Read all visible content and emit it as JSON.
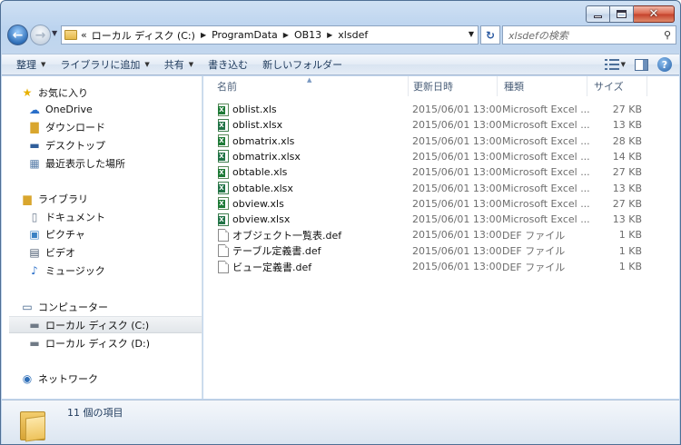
{
  "window": {
    "caption_buttons": {
      "close_symbol": "✕"
    }
  },
  "navbar": {
    "breadcrumb_overflow": "«",
    "breadcrumbs": [
      "ローカル ディスク (C:)",
      "ProgramData",
      "OB13",
      "xlsdef"
    ],
    "search_placeholder": "xlsdefの検索",
    "refresh_symbol": "↻",
    "back_symbol": "←",
    "forward_symbol": "→"
  },
  "toolbar": {
    "organize": "整理",
    "add_to_library": "ライブラリに追加",
    "share": "共有",
    "burn": "書き込む",
    "new_folder": "新しいフォルダー"
  },
  "navpane": {
    "favorites": "お気に入り",
    "onedrive": "OneDrive",
    "downloads": "ダウンロード",
    "desktop": "デスクトップ",
    "recent": "最近表示した場所",
    "libraries": "ライブラリ",
    "documents": "ドキュメント",
    "pictures": "ピクチャ",
    "videos": "ビデオ",
    "music": "ミュージック",
    "computer": "コンピューター",
    "local_c": "ローカル ディスク (C:)",
    "local_d": "ローカル ディスク (D:)",
    "network": "ネットワーク"
  },
  "columns": {
    "name": "名前",
    "date": "更新日時",
    "type": "種類",
    "size": "サイズ"
  },
  "files": [
    {
      "name": "oblist.xls",
      "date": "2015/06/01 13:00",
      "type": "Microsoft Excel ...",
      "size": "27 KB",
      "icon": "xls-icon"
    },
    {
      "name": "oblist.xlsx",
      "date": "2015/06/01 13:00",
      "type": "Microsoft Excel ...",
      "size": "13 KB",
      "icon": "xlsx-icon"
    },
    {
      "name": "obmatrix.xls",
      "date": "2015/06/01 13:00",
      "type": "Microsoft Excel ...",
      "size": "28 KB",
      "icon": "xls-icon"
    },
    {
      "name": "obmatrix.xlsx",
      "date": "2015/06/01 13:00",
      "type": "Microsoft Excel ...",
      "size": "14 KB",
      "icon": "xlsx-icon"
    },
    {
      "name": "obtable.xls",
      "date": "2015/06/01 13:00",
      "type": "Microsoft Excel ...",
      "size": "27 KB",
      "icon": "xls-icon"
    },
    {
      "name": "obtable.xlsx",
      "date": "2015/06/01 13:00",
      "type": "Microsoft Excel ...",
      "size": "13 KB",
      "icon": "xlsx-icon"
    },
    {
      "name": "obview.xls",
      "date": "2015/06/01 13:00",
      "type": "Microsoft Excel ...",
      "size": "27 KB",
      "icon": "xls-icon"
    },
    {
      "name": "obview.xlsx",
      "date": "2015/06/01 13:00",
      "type": "Microsoft Excel ...",
      "size": "13 KB",
      "icon": "xlsx-icon"
    },
    {
      "name": "オブジェクト一覧表.def",
      "date": "2015/06/01 13:00",
      "type": "DEF ファイル",
      "size": "1 KB",
      "icon": "def-icon"
    },
    {
      "name": "テーブル定義書.def",
      "date": "2015/06/01 13:00",
      "type": "DEF ファイル",
      "size": "1 KB",
      "icon": "def-icon"
    },
    {
      "name": "ビュー定義書.def",
      "date": "2015/06/01 13:00",
      "type": "DEF ファイル",
      "size": "1 KB",
      "icon": "def-icon"
    }
  ],
  "details": {
    "item_count": "11 個の項目"
  }
}
